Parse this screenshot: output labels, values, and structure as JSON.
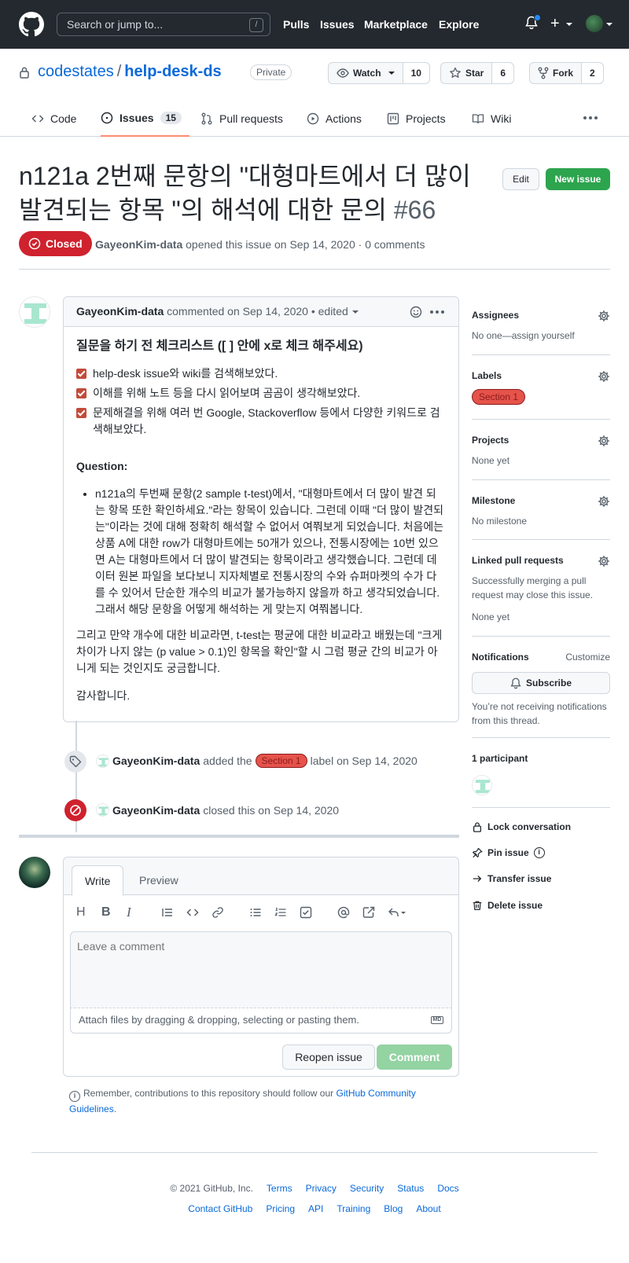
{
  "header": {
    "search_placeholder": "Search or jump to...",
    "search_shortcut": "/",
    "nav": [
      "Pulls",
      "Issues",
      "Marketplace",
      "Explore"
    ],
    "plus_label": "+"
  },
  "repo": {
    "owner": "codestates",
    "separator": "/",
    "name": "help-desk-ds",
    "visibility": "Private",
    "watch": {
      "label": "Watch",
      "count": "10"
    },
    "star": {
      "label": "Star",
      "count": "6"
    },
    "fork": {
      "label": "Fork",
      "count": "2"
    }
  },
  "tabs": [
    {
      "label": "Code",
      "icon": "code-icon"
    },
    {
      "label": "Issues",
      "icon": "issue-icon",
      "count": "15",
      "active": true
    },
    {
      "label": "Pull requests",
      "icon": "pull-request-icon"
    },
    {
      "label": "Actions",
      "icon": "play-icon"
    },
    {
      "label": "Projects",
      "icon": "project-icon"
    },
    {
      "label": "Wiki",
      "icon": "book-icon"
    }
  ],
  "issue": {
    "title": "n121a 2번째 문항의 \"대형마트에서 더 많이 발견되는 항목 \"의 해석에 대한 문의",
    "number": "#66",
    "edit_label": "Edit",
    "new_issue_label": "New issue",
    "state": "Closed",
    "author": "GayeonKim-data",
    "meta": "opened this issue on Sep 14, 2020 · 0 comments"
  },
  "comment": {
    "author": "GayeonKim-data",
    "meta": "commented on Sep 14, 2020",
    "edited": "• edited",
    "heading": "질문을 하기 전 체크리스트 ([ ] 안에 x로 체크 해주세요)",
    "checklist": [
      "help-desk issue와 wiki를 검색해보았다.",
      "이해를 위해 노트 등을 다시 읽어보며 곰곰이 생각해보았다.",
      "문제해결을 위해 여러 번 Google, Stackoverflow 등에서 다양한 키워드로 검색해보았다."
    ],
    "question_heading": "Question:",
    "bullet": "n121a의 두번째 문항(2 sample t-test)에서, \"대형마트에서 더 많이 발견 되는 항목 또한 확인하세요.\"라는 항목이 있습니다. 그런데 이때 \"더 많이 발견되는\"이라는 것에 대해 정확히 해석할 수 없어서 여쭤보게 되었습니다. 처음에는 상품 A에 대한 row가 대형마트에는 50개가 있으나, 전통시장에는 10번 있으면 A는 대형마트에서 더 많이 발견되는 항목이라고 생각했습니다. 그런데 데이터 원본 파일을 보다보니 지자체별로 전통시장의 수와 슈퍼마켓의 수가 다를 수 있어서 단순한 개수의 비교가 불가능하지 않을까 하고 생각되었습니다. 그래서 해당 문항을 어떻게 해석하는 게 맞는지 여쭤봅니다.",
    "para": "그리고 만약 개수에 대한 비교라면, t-test는 평균에 대한 비교라고 배웠는데 \"크게 차이가 나지 않는 (p value > 0.1)인 항목을 확인\"할 시 그럼 평균 간의 비교가 아니게 되는 것인지도 궁금합니다.",
    "thanks": "감사합니다."
  },
  "events": [
    {
      "actor": "GayeonKim-data",
      "pre": "added the",
      "label": "Section 1",
      "post": "label on Sep 14, 2020"
    },
    {
      "actor": "GayeonKim-data",
      "text": "closed this on Sep 14, 2020"
    }
  ],
  "composer": {
    "tab_write": "Write",
    "tab_preview": "Preview",
    "placeholder": "Leave a comment",
    "attach": "Attach files by dragging & dropping, selecting or pasting them.",
    "md": "MD",
    "reopen": "Reopen issue",
    "submit": "Comment",
    "remember": "Remember, contributions to this repository should follow our",
    "guidelines_link": "GitHub Community Guidelines",
    "remember_end": "."
  },
  "sidebar": {
    "assignees": {
      "title": "Assignees",
      "value": "No one—assign yourself"
    },
    "labels": {
      "title": "Labels",
      "value": "Section 1"
    },
    "projects": {
      "title": "Projects",
      "value": "None yet"
    },
    "milestone": {
      "title": "Milestone",
      "value": "No milestone"
    },
    "linked_prs": {
      "title": "Linked pull requests",
      "value": "Successfully merging a pull request may close this issue.",
      "value2": "None yet"
    },
    "notifications": {
      "title": "Notifications",
      "customize": "Customize",
      "subscribe": "Subscribe",
      "note": "You’re not receiving notifications from this thread."
    },
    "participants": {
      "title": "1 participant"
    },
    "actions": [
      "Lock conversation",
      "Pin issue",
      "Transfer issue",
      "Delete issue"
    ]
  },
  "footer": {
    "copyright": "© 2021 GitHub, Inc.",
    "row1": [
      "Terms",
      "Privacy",
      "Security",
      "Status",
      "Docs"
    ],
    "row2": [
      "Contact GitHub",
      "Pricing",
      "API",
      "Training",
      "Blog",
      "About"
    ]
  },
  "colors": {
    "accent": "#0969da",
    "closed": "#cf222e",
    "label": "#e5534b",
    "green": "#2da44e"
  }
}
